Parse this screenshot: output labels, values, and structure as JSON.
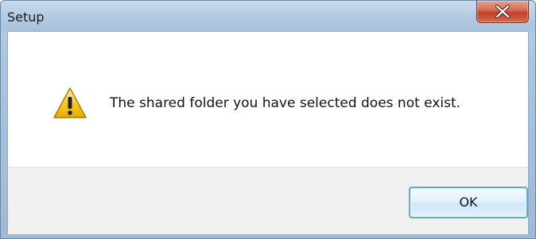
{
  "window": {
    "title": "Setup"
  },
  "title_bar": {
    "close_icon": "close-x-icon"
  },
  "dialog": {
    "icon": "warning-triangle-icon",
    "message": "The shared folder you have selected does not exist."
  },
  "buttons": {
    "ok_label": "OK"
  },
  "colors": {
    "frame": "#a9c4df",
    "close_button": "#c94a33",
    "warning_yellow": "#f2c200",
    "ok_border": "#5da8d6",
    "footer_bg": "#f0f0f0"
  }
}
